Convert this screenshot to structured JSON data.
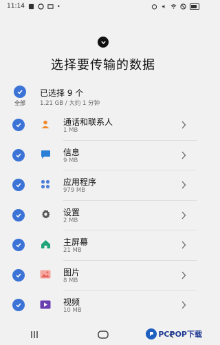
{
  "status_bar": {
    "time": "11:14"
  },
  "header": {
    "title": "选择要传输的数据"
  },
  "select_all": {
    "label": "全部",
    "selected_title": "已选择 9 个",
    "selected_sub": "1.21 GB / 大约 1 分钟"
  },
  "items": [
    {
      "name": "通话和联系人",
      "size": "1 MB",
      "icon": "contacts-icon",
      "color": "#f08a2a"
    },
    {
      "name": "信息",
      "size": "9 MB",
      "icon": "messages-icon",
      "color": "#2a7fd6"
    },
    {
      "name": "应用程序",
      "size": "979 MB",
      "icon": "apps-icon",
      "color": "#4f7fd8"
    },
    {
      "name": "设置",
      "size": "2 MB",
      "icon": "settings-icon",
      "color": "#555555"
    },
    {
      "name": "主屏幕",
      "size": "21 MB",
      "icon": "home-icon",
      "color": "#1fa37a"
    },
    {
      "name": "图片",
      "size": "8 MB",
      "icon": "image-icon",
      "color": "#e5625a"
    },
    {
      "name": "视频",
      "size": "10 MB",
      "icon": "video-icon",
      "color": "#6a3fb0"
    }
  ],
  "watermark": {
    "text": "PCPOP下载"
  },
  "colors": {
    "accent": "#3b73d6",
    "background": "#f1f1f1"
  }
}
